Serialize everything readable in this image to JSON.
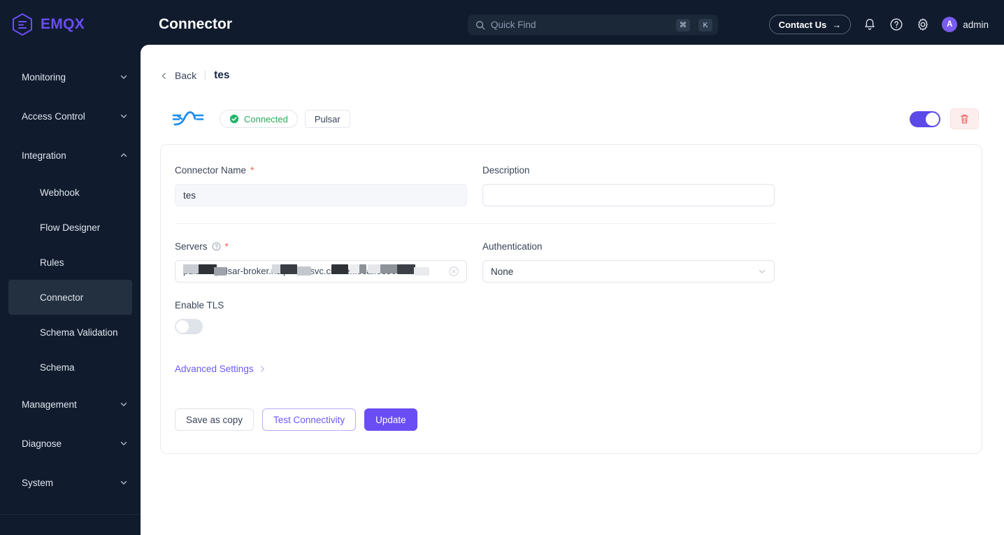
{
  "app": {
    "brand": "EMQX",
    "page_title": "Connector"
  },
  "search": {
    "placeholder": "Quick Find",
    "kbd_mod": "⌘",
    "kbd_key": "K"
  },
  "header": {
    "contact_label": "Contact Us",
    "contact_arrow": "→",
    "user_initial": "A",
    "username": "admin"
  },
  "sidebar": {
    "groups": [
      {
        "label": "Monitoring",
        "expanded": false
      },
      {
        "label": "Access Control",
        "expanded": false
      },
      {
        "label": "Integration",
        "expanded": true
      }
    ],
    "integration_items": [
      {
        "label": "Webhook",
        "active": false
      },
      {
        "label": "Flow Designer",
        "active": false
      },
      {
        "label": "Rules",
        "active": false
      },
      {
        "label": "Connector",
        "active": true
      },
      {
        "label": "Schema Validation",
        "active": false
      },
      {
        "label": "Schema",
        "active": false
      }
    ],
    "groups_bottom": [
      {
        "label": "Management",
        "expanded": false
      },
      {
        "label": "Diagnose",
        "expanded": false
      },
      {
        "label": "System",
        "expanded": false
      }
    ],
    "footer_left": "",
    "footer_right": ""
  },
  "breadcrumb": {
    "back_label": "Back",
    "current": "tes"
  },
  "status": {
    "connection_label": "Connected",
    "type_label": "Pulsar",
    "enabled": true,
    "accent_green": "#2aab5c",
    "accent_purple": "#5b4ae8",
    "accent_red": "#e8615c"
  },
  "form": {
    "connector_name": {
      "label": "Connector Name",
      "required": true,
      "value": "tes",
      "readonly": true
    },
    "description": {
      "label": "Description",
      "required": false,
      "value": "",
      "placeholder": ""
    },
    "servers": {
      "label": "Servers",
      "required": true,
      "has_help": true,
      "value": "pulsar://pulsar-broker.ns.pulsar.svc.cluster.local:6650",
      "redacted": true
    },
    "authentication": {
      "label": "Authentication",
      "required": false,
      "value": "None"
    },
    "enable_tls": {
      "label": "Enable TLS",
      "value": false
    },
    "advanced_settings_label": "Advanced Settings"
  },
  "actions": {
    "save_as_copy": "Save as copy",
    "test_connectivity": "Test Connectivity",
    "update": "Update"
  }
}
